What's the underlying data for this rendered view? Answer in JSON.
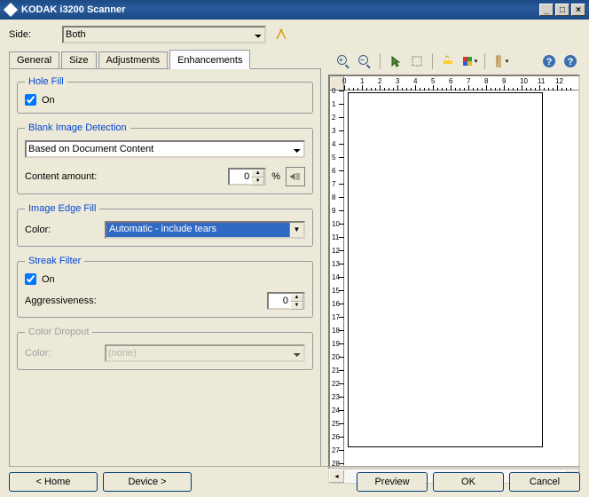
{
  "window": {
    "title": "KODAK i3200 Scanner"
  },
  "side": {
    "label": "Side:",
    "value": "Both"
  },
  "tabs": {
    "general": "General",
    "size": "Size",
    "adjustments": "Adjustments",
    "enhancements": "Enhancements"
  },
  "holeFill": {
    "legend": "Hole Fill",
    "onLabel": "On"
  },
  "blankImage": {
    "legend": "Blank Image Detection",
    "mode": "Based on Document Content",
    "contentLabel": "Content amount:",
    "contentValue": "0",
    "percent": "%"
  },
  "edgeFill": {
    "legend": "Image Edge Fill",
    "colorLabel": "Color:",
    "colorValue": "Automatic - include tears"
  },
  "streak": {
    "legend": "Streak Filter",
    "onLabel": "On",
    "aggLabel": "Aggressiveness:",
    "aggValue": "0"
  },
  "dropout": {
    "legend": "Color Dropout",
    "colorLabel": "Color:",
    "colorValue": "(none)"
  },
  "buttons": {
    "home": "< Home",
    "device": "Device >",
    "preview": "Preview",
    "ok": "OK",
    "cancel": "Cancel"
  },
  "ruler": {
    "h": [
      "0",
      "1",
      "2",
      "3",
      "4",
      "5",
      "6",
      "7",
      "8",
      "9",
      "10",
      "11",
      "12"
    ],
    "v": [
      "0",
      "1",
      "2",
      "3",
      "4",
      "5",
      "6",
      "7",
      "8",
      "9",
      "10",
      "11",
      "12",
      "13",
      "14",
      "15",
      "16",
      "17",
      "18",
      "19",
      "20",
      "21",
      "22",
      "23",
      "24",
      "25",
      "26",
      "27",
      "28"
    ]
  }
}
